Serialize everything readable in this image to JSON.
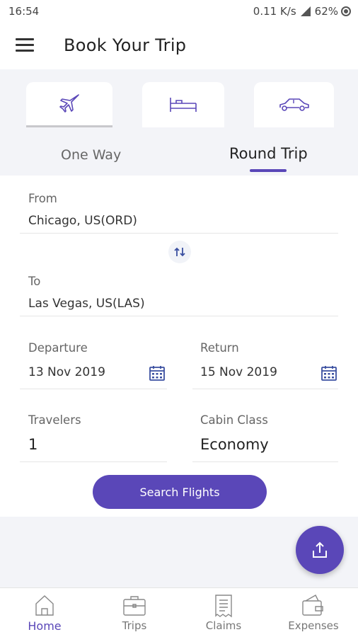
{
  "status_bar": {
    "time": "16:54",
    "network_speed": "0.11 K/s",
    "signal_icon": "signal-icon",
    "battery": "62%"
  },
  "app_bar": {
    "title": "Book Your Trip",
    "menu_icon": "menu-icon"
  },
  "modes": [
    {
      "icon": "airplane-icon",
      "selected": true
    },
    {
      "icon": "bed-icon",
      "selected": false
    },
    {
      "icon": "car-icon",
      "selected": false
    }
  ],
  "trip_tabs": {
    "one_way": "One Way",
    "round_trip": "Round Trip",
    "active": "round_trip"
  },
  "form": {
    "from_label": "From",
    "from_value": "Chicago, US(ORD)",
    "to_label": "To",
    "to_value": "Las Vegas, US(LAS)",
    "departure_label": "Departure",
    "departure_value": "13 Nov 2019",
    "return_label": "Return",
    "return_value": "15 Nov 2019",
    "travelers_label": "Travelers",
    "travelers_value": "1",
    "cabin_label": "Cabin Class",
    "cabin_value": "Economy",
    "search_button": "Search Flights"
  },
  "fab_icon": "share-icon",
  "bottom_nav": [
    {
      "label": "Home",
      "icon": "home-icon",
      "active": true
    },
    {
      "label": "Trips",
      "icon": "briefcase-icon",
      "active": false
    },
    {
      "label": "Claims",
      "icon": "receipt-icon",
      "active": false
    },
    {
      "label": "Expenses",
      "icon": "wallet-icon",
      "active": false
    }
  ],
  "colors": {
    "accent": "#5a47b8",
    "background_grey": "#f3f4f8"
  }
}
